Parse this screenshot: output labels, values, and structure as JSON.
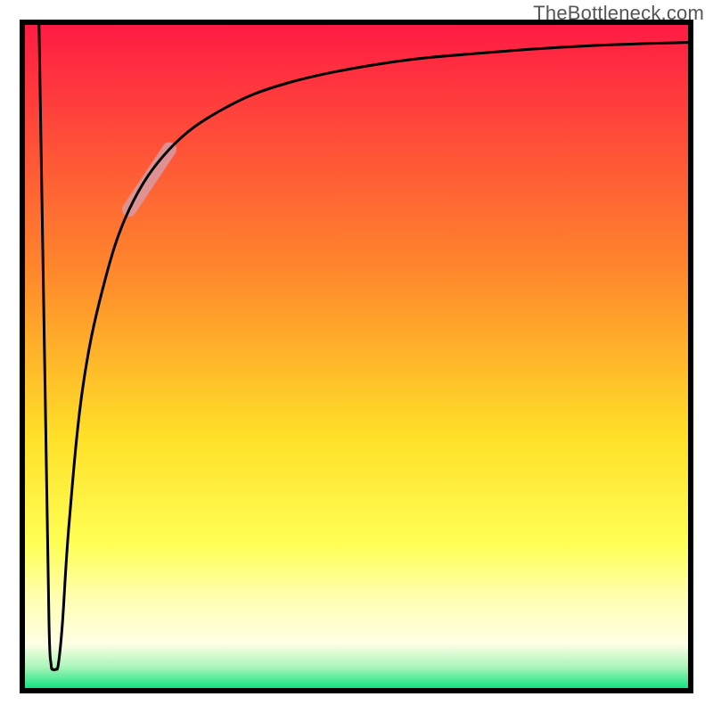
{
  "watermark": "TheBottleneck.com",
  "chart_data": {
    "type": "line",
    "title": "",
    "xlabel": "",
    "ylabel": "",
    "xlim": [
      0,
      100
    ],
    "ylim": [
      0,
      100
    ],
    "background_gradient": {
      "stops": [
        {
          "offset": 0.0,
          "color": "#ff1a44"
        },
        {
          "offset": 0.38,
          "color": "#ff8a2b"
        },
        {
          "offset": 0.62,
          "color": "#ffe028"
        },
        {
          "offset": 0.78,
          "color": "#ffff55"
        },
        {
          "offset": 0.86,
          "color": "#ffffb0"
        },
        {
          "offset": 0.93,
          "color": "#ffffe6"
        },
        {
          "offset": 0.965,
          "color": "#a8f5b8"
        },
        {
          "offset": 1.0,
          "color": "#00e27a"
        }
      ]
    },
    "series": [
      {
        "name": "curve",
        "description": "Sharp spike down from top-left to near bottom at x≈4, then asymptotic rise toward top-right",
        "points": [
          {
            "x": 2.5,
            "y": 100
          },
          {
            "x": 3.0,
            "y": 70
          },
          {
            "x": 3.5,
            "y": 40
          },
          {
            "x": 4.0,
            "y": 10
          },
          {
            "x": 4.3,
            "y": 4
          },
          {
            "x": 4.6,
            "y": 3.2
          },
          {
            "x": 5.0,
            "y": 3.2
          },
          {
            "x": 5.4,
            "y": 4
          },
          {
            "x": 6.0,
            "y": 10
          },
          {
            "x": 7.0,
            "y": 25
          },
          {
            "x": 9.0,
            "y": 45
          },
          {
            "x": 12.0,
            "y": 60
          },
          {
            "x": 16.0,
            "y": 72
          },
          {
            "x": 22.0,
            "y": 81
          },
          {
            "x": 30.0,
            "y": 87
          },
          {
            "x": 40.0,
            "y": 91
          },
          {
            "x": 55.0,
            "y": 94
          },
          {
            "x": 70.0,
            "y": 95.5
          },
          {
            "x": 85.0,
            "y": 96.5
          },
          {
            "x": 100.0,
            "y": 97
          }
        ]
      }
    ],
    "highlight_segment": {
      "description": "Thicker pale band along curve",
      "x_start": 16,
      "x_end": 22,
      "color": "#d89aa2",
      "width": 16
    },
    "frame": {
      "inset": 25,
      "stroke": "#000000",
      "stroke_width": 6
    }
  }
}
